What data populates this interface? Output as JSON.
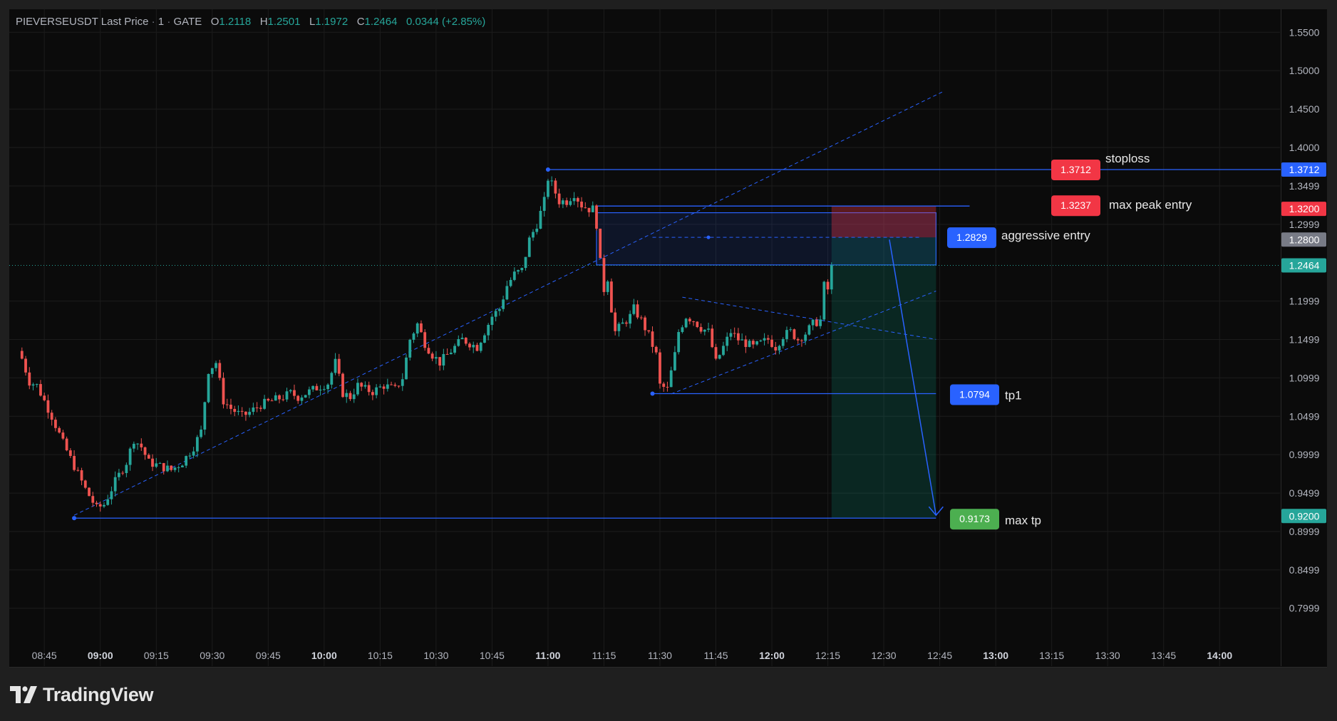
{
  "header": {
    "symbol": "PIEVERSEUSDT Last Price",
    "interval": "1",
    "exchange": "GATE",
    "open_label": "O",
    "open": "1.2118",
    "high_label": "H",
    "high": "1.2501",
    "low_label": "L",
    "low": "1.1972",
    "close_label": "C",
    "close": "1.2464",
    "change": "0.0344 (+2.85%)"
  },
  "brand": {
    "name": "TradingView",
    "icon": "tradingview-logo-icon"
  },
  "colors": {
    "background": "#0b0b0b",
    "frame": "#1f1f1f",
    "grid": "#1c1c1c",
    "up": "#26a69a",
    "down": "#ef5350",
    "line": "#2962ff",
    "stop_label": "#f23645",
    "entry_label": "#2962ff",
    "tp_label": "#4caf50",
    "text": "#b2b5be"
  },
  "chart_data": {
    "type": "candlestick",
    "symbol": "PIEVERSEUSDT",
    "interval": "1",
    "exchange": "GATE",
    "y_axis": {
      "range": [
        0.77,
        1.56
      ],
      "ticks": [
        "1.5500",
        "1.5000",
        "1.4500",
        "1.4000",
        "1.3499",
        "1.2999",
        "1.1999",
        "1.1499",
        "1.0999",
        "1.0499",
        "0.9999",
        "0.9499",
        "0.8999",
        "0.8499",
        "0.7999"
      ]
    },
    "x_axis": {
      "ticks": [
        {
          "t": "08:45",
          "m": 525,
          "bold": false
        },
        {
          "t": "09:00",
          "m": 540,
          "bold": true
        },
        {
          "t": "09:15",
          "m": 555,
          "bold": false
        },
        {
          "t": "09:30",
          "m": 570,
          "bold": false
        },
        {
          "t": "09:45",
          "m": 585,
          "bold": false
        },
        {
          "t": "10:00",
          "m": 600,
          "bold": true
        },
        {
          "t": "10:15",
          "m": 615,
          "bold": false
        },
        {
          "t": "10:30",
          "m": 630,
          "bold": false
        },
        {
          "t": "10:45",
          "m": 645,
          "bold": false
        },
        {
          "t": "11:00",
          "m": 660,
          "bold": true
        },
        {
          "t": "11:15",
          "m": 675,
          "bold": false
        },
        {
          "t": "11:30",
          "m": 690,
          "bold": false
        },
        {
          "t": "11:45",
          "m": 705,
          "bold": false
        },
        {
          "t": "12:00",
          "m": 720,
          "bold": true
        },
        {
          "t": "12:15",
          "m": 735,
          "bold": false
        },
        {
          "t": "12:30",
          "m": 750,
          "bold": false
        },
        {
          "t": "12:45",
          "m": 765,
          "bold": false
        },
        {
          "t": "13:00",
          "m": 780,
          "bold": true
        },
        {
          "t": "13:15",
          "m": 795,
          "bold": false
        },
        {
          "t": "13:30",
          "m": 810,
          "bold": false
        },
        {
          "t": "13:45",
          "m": 825,
          "bold": false
        },
        {
          "t": "14:00",
          "m": 840,
          "bold": true
        }
      ]
    },
    "price_scale_labels": [
      {
        "price": "1.3712",
        "v": 1.3712,
        "color": "#2962ff"
      },
      {
        "price": "1.3200",
        "v": 1.32,
        "color": "#f23645"
      },
      {
        "price": "1.2800",
        "v": 1.28,
        "color": "#787b86"
      },
      {
        "price": "1.2464",
        "v": 1.2464,
        "color": "#26a69a"
      },
      {
        "price": "0.9200",
        "v": 0.92,
        "color": "#26a69a"
      }
    ],
    "last_price": 1.2464,
    "keypoints": [
      {
        "m": 519,
        "c": 1.125
      },
      {
        "m": 521,
        "c": 1.095
      },
      {
        "m": 523,
        "c": 1.09
      },
      {
        "m": 525,
        "c": 1.07
      },
      {
        "m": 527,
        "c": 1.05
      },
      {
        "m": 530,
        "c": 1.015
      },
      {
        "m": 533,
        "c": 0.985
      },
      {
        "m": 536,
        "c": 0.955
      },
      {
        "m": 539,
        "c": 0.93
      },
      {
        "m": 541,
        "c": 0.935
      },
      {
        "m": 544,
        "c": 0.965
      },
      {
        "m": 547,
        "c": 0.99
      },
      {
        "m": 549,
        "c": 1.02
      },
      {
        "m": 551,
        "c": 1.01
      },
      {
        "m": 553,
        "c": 0.99
      },
      {
        "m": 556,
        "c": 0.985
      },
      {
        "m": 559,
        "c": 0.98
      },
      {
        "m": 562,
        "c": 0.99
      },
      {
        "m": 565,
        "c": 1.01
      },
      {
        "m": 567,
        "c": 1.03
      },
      {
        "m": 569,
        "c": 1.11
      },
      {
        "m": 571,
        "c": 1.12
      },
      {
        "m": 573,
        "c": 1.07
      },
      {
        "m": 575,
        "c": 1.06
      },
      {
        "m": 578,
        "c": 1.05
      },
      {
        "m": 580,
        "c": 1.055
      },
      {
        "m": 583,
        "c": 1.065
      },
      {
        "m": 586,
        "c": 1.07
      },
      {
        "m": 589,
        "c": 1.075
      },
      {
        "m": 591,
        "c": 1.08
      },
      {
        "m": 593,
        "c": 1.075
      },
      {
        "m": 596,
        "c": 1.082
      },
      {
        "m": 598,
        "c": 1.087
      },
      {
        "m": 601,
        "c": 1.093
      },
      {
        "m": 603,
        "c": 1.12
      },
      {
        "m": 605,
        "c": 1.08
      },
      {
        "m": 607,
        "c": 1.075
      },
      {
        "m": 609,
        "c": 1.09
      },
      {
        "m": 611,
        "c": 1.085
      },
      {
        "m": 613,
        "c": 1.082
      },
      {
        "m": 616,
        "c": 1.09
      },
      {
        "m": 619,
        "c": 1.085
      },
      {
        "m": 621,
        "c": 1.1
      },
      {
        "m": 623,
        "c": 1.15
      },
      {
        "m": 625,
        "c": 1.17
      },
      {
        "m": 627,
        "c": 1.145
      },
      {
        "m": 629,
        "c": 1.13
      },
      {
        "m": 631,
        "c": 1.12
      },
      {
        "m": 633,
        "c": 1.13
      },
      {
        "m": 635,
        "c": 1.14
      },
      {
        "m": 637,
        "c": 1.15
      },
      {
        "m": 639,
        "c": 1.145
      },
      {
        "m": 641,
        "c": 1.14
      },
      {
        "m": 643,
        "c": 1.16
      },
      {
        "m": 645,
        "c": 1.18
      },
      {
        "m": 647,
        "c": 1.19
      },
      {
        "m": 649,
        "c": 1.22
      },
      {
        "m": 651,
        "c": 1.235
      },
      {
        "m": 653,
        "c": 1.24
      },
      {
        "m": 655,
        "c": 1.28
      },
      {
        "m": 657,
        "c": 1.3
      },
      {
        "m": 659,
        "c": 1.33
      },
      {
        "m": 660,
        "c": 1.36
      },
      {
        "m": 661,
        "c": 1.352
      },
      {
        "m": 663,
        "c": 1.33
      },
      {
        "m": 665,
        "c": 1.33
      },
      {
        "m": 667,
        "c": 1.34
      },
      {
        "m": 669,
        "c": 1.325
      },
      {
        "m": 671,
        "c": 1.32
      },
      {
        "m": 672,
        "c": 1.32
      },
      {
        "m": 673,
        "c": 1.3
      },
      {
        "m": 674,
        "c": 1.25
      },
      {
        "m": 675,
        "c": 1.215
      },
      {
        "m": 676,
        "c": 1.23
      },
      {
        "m": 677,
        "c": 1.19
      },
      {
        "m": 678,
        "c": 1.16
      },
      {
        "m": 680,
        "c": 1.17
      },
      {
        "m": 682,
        "c": 1.18
      },
      {
        "m": 683,
        "c": 1.19
      },
      {
        "m": 685,
        "c": 1.175
      },
      {
        "m": 687,
        "c": 1.155
      },
      {
        "m": 689,
        "c": 1.13
      },
      {
        "m": 690,
        "c": 1.09
      },
      {
        "m": 692,
        "c": 1.085
      },
      {
        "m": 694,
        "c": 1.13
      },
      {
        "m": 695,
        "c": 1.16
      },
      {
        "m": 697,
        "c": 1.18
      },
      {
        "m": 699,
        "c": 1.175
      },
      {
        "m": 701,
        "c": 1.165
      },
      {
        "m": 703,
        "c": 1.16
      },
      {
        "m": 705,
        "c": 1.12
      },
      {
        "m": 707,
        "c": 1.14
      },
      {
        "m": 709,
        "c": 1.16
      },
      {
        "m": 711,
        "c": 1.15
      },
      {
        "m": 713,
        "c": 1.145
      },
      {
        "m": 715,
        "c": 1.14
      },
      {
        "m": 717,
        "c": 1.145
      },
      {
        "m": 719,
        "c": 1.15
      },
      {
        "m": 721,
        "c": 1.14
      },
      {
        "m": 723,
        "c": 1.155
      },
      {
        "m": 725,
        "c": 1.16
      },
      {
        "m": 727,
        "c": 1.15
      },
      {
        "m": 729,
        "c": 1.158
      },
      {
        "m": 731,
        "c": 1.17
      },
      {
        "m": 733,
        "c": 1.175
      },
      {
        "m": 734,
        "c": 1.22
      },
      {
        "m": 735,
        "c": 1.215
      },
      {
        "m": 736,
        "c": 1.2464
      }
    ],
    "annotations": {
      "stoploss": {
        "price": 1.3712,
        "label": "1.3712",
        "text": "stoploss"
      },
      "max_peak_entry": {
        "price": 1.3237,
        "label": "1.3237",
        "text": "max peak entry"
      },
      "aggressive_entry": {
        "price": 1.2829,
        "label": "1.2829",
        "text": "aggressive entry"
      },
      "tp1": {
        "price": 1.0794,
        "label": "1.0794",
        "text": "tp1"
      },
      "max_tp": {
        "price": 0.9173,
        "label": "0.9173",
        "text": "max tp"
      }
    },
    "zones": {
      "entry_zone": {
        "from_m": 673,
        "to_m": 764,
        "top": 1.315,
        "bottom": 1.247
      },
      "risk_zone": {
        "from_m": 736,
        "to_m": 764,
        "top": 1.3237,
        "bottom": 1.2829
      },
      "reward_zone": {
        "from_m": 736,
        "to_m": 764,
        "top": 1.2829,
        "bottom": 0.9173
      }
    }
  }
}
